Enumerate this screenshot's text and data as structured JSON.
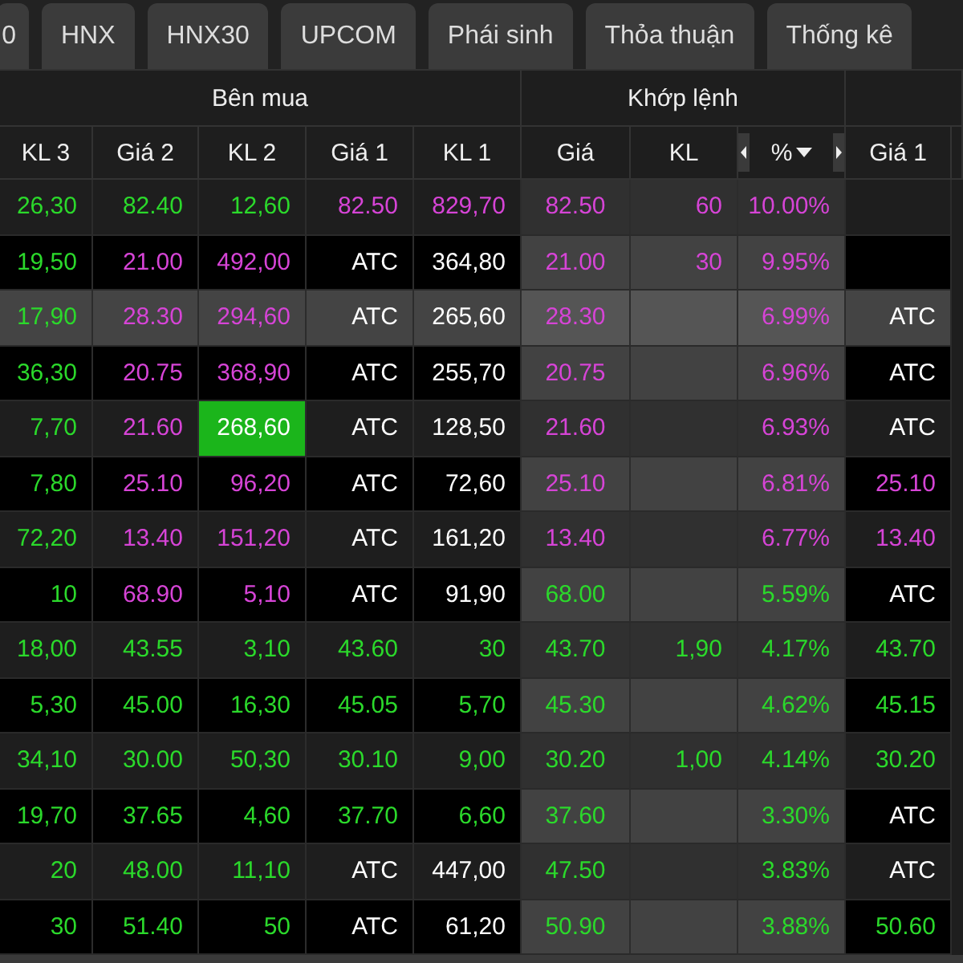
{
  "tabs": [
    {
      "label": "0",
      "selected": false
    },
    {
      "label": "HNX",
      "selected": false
    },
    {
      "label": "HNX30",
      "selected": false
    },
    {
      "label": "UPCOM",
      "selected": false
    },
    {
      "label": "Phái sinh",
      "selected": false
    },
    {
      "label": "Thỏa thuận",
      "selected": false
    },
    {
      "label": "Thống kê",
      "selected": false
    }
  ],
  "board": {
    "groups": [
      {
        "label": "Bên mua",
        "kind": "buy",
        "columns": [
          {
            "label": "KL 3",
            "kind": "plain"
          },
          {
            "label": "Giá 2",
            "kind": "plain"
          },
          {
            "label": "KL 2",
            "kind": "plain"
          },
          {
            "label": "Giá 1",
            "kind": "plain"
          },
          {
            "label": "KL 1",
            "kind": "plain"
          }
        ]
      },
      {
        "label": "Khớp lệnh",
        "kind": "match",
        "columns": [
          {
            "label": "Giá",
            "kind": "plain"
          },
          {
            "label": "KL",
            "kind": "plain"
          },
          {
            "label": "%",
            "kind": "sort"
          }
        ]
      },
      {
        "kind": "sell",
        "columns": [
          {
            "label": "Giá 1",
            "kind": "plain"
          }
        ]
      }
    ],
    "rows": [
      {
        "selected": false,
        "cells": [
          {
            "text": "26,30",
            "color": "#2bd92b",
            "highlighted": false
          },
          {
            "text": "82.40",
            "color": "#2bd92b",
            "highlighted": false
          },
          {
            "text": "12,60",
            "color": "#2bd92b",
            "highlighted": false
          },
          {
            "text": "82.50",
            "color": "#d644d6",
            "highlighted": false
          },
          {
            "text": "829,70",
            "color": "#d644d6",
            "highlighted": false
          },
          {
            "text": "82.50",
            "color": "#d644d6",
            "highlighted": false
          },
          {
            "text": "60",
            "color": "#d644d6",
            "highlighted": false
          },
          {
            "text": "10.00%",
            "color": "#d644d6",
            "highlighted": false
          },
          null
        ]
      },
      {
        "selected": false,
        "cells": [
          {
            "text": "19,50",
            "color": "#2bd92b",
            "highlighted": false
          },
          {
            "text": "21.00",
            "color": "#d644d6",
            "highlighted": false
          },
          {
            "text": "492,00",
            "color": "#d644d6",
            "highlighted": false
          },
          {
            "text": "ATC",
            "color": "#ffffff",
            "highlighted": false
          },
          {
            "text": "364,80",
            "color": "#ffffff",
            "highlighted": false
          },
          {
            "text": "21.00",
            "color": "#d644d6",
            "highlighted": false
          },
          {
            "text": "30",
            "color": "#d644d6",
            "highlighted": false
          },
          {
            "text": "9.95%",
            "color": "#d644d6",
            "highlighted": false
          },
          null
        ]
      },
      {
        "selected": true,
        "cells": [
          {
            "text": "17,90",
            "color": "#2bd92b",
            "highlighted": false
          },
          {
            "text": "28.30",
            "color": "#d644d6",
            "highlighted": false
          },
          {
            "text": "294,60",
            "color": "#d644d6",
            "highlighted": false
          },
          {
            "text": "ATC",
            "color": "#ffffff",
            "highlighted": false
          },
          {
            "text": "265,60",
            "color": "#ffffff",
            "highlighted": false
          },
          {
            "text": "28.30",
            "color": "#d644d6",
            "highlighted": false
          },
          null,
          {
            "text": "6.99%",
            "color": "#d644d6",
            "highlighted": false
          },
          {
            "text": "ATC",
            "color": "#ffffff",
            "highlighted": false
          }
        ]
      },
      {
        "selected": false,
        "cells": [
          {
            "text": "36,30",
            "color": "#2bd92b",
            "highlighted": false
          },
          {
            "text": "20.75",
            "color": "#d644d6",
            "highlighted": false
          },
          {
            "text": "368,90",
            "color": "#d644d6",
            "highlighted": false
          },
          {
            "text": "ATC",
            "color": "#ffffff",
            "highlighted": false
          },
          {
            "text": "255,70",
            "color": "#ffffff",
            "highlighted": false
          },
          {
            "text": "20.75",
            "color": "#d644d6",
            "highlighted": false
          },
          null,
          {
            "text": "6.96%",
            "color": "#d644d6",
            "highlighted": false
          },
          {
            "text": "ATC",
            "color": "#ffffff",
            "highlighted": false
          }
        ]
      },
      {
        "selected": false,
        "cells": [
          {
            "text": "7,70",
            "color": "#2bd92b",
            "highlighted": false
          },
          {
            "text": "21.60",
            "color": "#d644d6",
            "highlighted": false
          },
          {
            "text": "268,60",
            "color": "#ffffff",
            "highlighted": true
          },
          {
            "text": "ATC",
            "color": "#ffffff",
            "highlighted": false
          },
          {
            "text": "128,50",
            "color": "#ffffff",
            "highlighted": false
          },
          {
            "text": "21.60",
            "color": "#d644d6",
            "highlighted": false
          },
          null,
          {
            "text": "6.93%",
            "color": "#d644d6",
            "highlighted": false
          },
          {
            "text": "ATC",
            "color": "#ffffff",
            "highlighted": false
          }
        ]
      },
      {
        "selected": false,
        "cells": [
          {
            "text": "7,80",
            "color": "#2bd92b",
            "highlighted": false
          },
          {
            "text": "25.10",
            "color": "#d644d6",
            "highlighted": false
          },
          {
            "text": "96,20",
            "color": "#d644d6",
            "highlighted": false
          },
          {
            "text": "ATC",
            "color": "#ffffff",
            "highlighted": false
          },
          {
            "text": "72,60",
            "color": "#ffffff",
            "highlighted": false
          },
          {
            "text": "25.10",
            "color": "#d644d6",
            "highlighted": false
          },
          null,
          {
            "text": "6.81%",
            "color": "#d644d6",
            "highlighted": false
          },
          {
            "text": "25.10",
            "color": "#d644d6",
            "highlighted": false
          }
        ]
      },
      {
        "selected": false,
        "cells": [
          {
            "text": "72,20",
            "color": "#2bd92b",
            "highlighted": false
          },
          {
            "text": "13.40",
            "color": "#d644d6",
            "highlighted": false
          },
          {
            "text": "151,20",
            "color": "#d644d6",
            "highlighted": false
          },
          {
            "text": "ATC",
            "color": "#ffffff",
            "highlighted": false
          },
          {
            "text": "161,20",
            "color": "#ffffff",
            "highlighted": false
          },
          {
            "text": "13.40",
            "color": "#d644d6",
            "highlighted": false
          },
          null,
          {
            "text": "6.77%",
            "color": "#d644d6",
            "highlighted": false
          },
          {
            "text": "13.40",
            "color": "#d644d6",
            "highlighted": false
          }
        ]
      },
      {
        "selected": false,
        "cells": [
          {
            "text": "10",
            "color": "#2bd92b",
            "highlighted": false
          },
          {
            "text": "68.90",
            "color": "#d644d6",
            "highlighted": false
          },
          {
            "text": "5,10",
            "color": "#d644d6",
            "highlighted": false
          },
          {
            "text": "ATC",
            "color": "#ffffff",
            "highlighted": false
          },
          {
            "text": "91,90",
            "color": "#ffffff",
            "highlighted": false
          },
          {
            "text": "68.00",
            "color": "#2bd92b",
            "highlighted": false
          },
          null,
          {
            "text": "5.59%",
            "color": "#2bd92b",
            "highlighted": false
          },
          {
            "text": "ATC",
            "color": "#ffffff",
            "highlighted": false
          }
        ]
      },
      {
        "selected": false,
        "cells": [
          {
            "text": "18,00",
            "color": "#2bd92b",
            "highlighted": false
          },
          {
            "text": "43.55",
            "color": "#2bd92b",
            "highlighted": false
          },
          {
            "text": "3,10",
            "color": "#2bd92b",
            "highlighted": false
          },
          {
            "text": "43.60",
            "color": "#2bd92b",
            "highlighted": false
          },
          {
            "text": "30",
            "color": "#2bd92b",
            "highlighted": false
          },
          {
            "text": "43.70",
            "color": "#2bd92b",
            "highlighted": false
          },
          {
            "text": "1,90",
            "color": "#2bd92b",
            "highlighted": false
          },
          {
            "text": "4.17%",
            "color": "#2bd92b",
            "highlighted": false
          },
          {
            "text": "43.70",
            "color": "#2bd92b",
            "highlighted": false
          }
        ]
      },
      {
        "selected": false,
        "cells": [
          {
            "text": "5,30",
            "color": "#2bd92b",
            "highlighted": false
          },
          {
            "text": "45.00",
            "color": "#2bd92b",
            "highlighted": false
          },
          {
            "text": "16,30",
            "color": "#2bd92b",
            "highlighted": false
          },
          {
            "text": "45.05",
            "color": "#2bd92b",
            "highlighted": false
          },
          {
            "text": "5,70",
            "color": "#2bd92b",
            "highlighted": false
          },
          {
            "text": "45.30",
            "color": "#2bd92b",
            "highlighted": false
          },
          null,
          {
            "text": "4.62%",
            "color": "#2bd92b",
            "highlighted": false
          },
          {
            "text": "45.15",
            "color": "#2bd92b",
            "highlighted": false
          }
        ]
      },
      {
        "selected": false,
        "cells": [
          {
            "text": "34,10",
            "color": "#2bd92b",
            "highlighted": false
          },
          {
            "text": "30.00",
            "color": "#2bd92b",
            "highlighted": false
          },
          {
            "text": "50,30",
            "color": "#2bd92b",
            "highlighted": false
          },
          {
            "text": "30.10",
            "color": "#2bd92b",
            "highlighted": false
          },
          {
            "text": "9,00",
            "color": "#2bd92b",
            "highlighted": false
          },
          {
            "text": "30.20",
            "color": "#2bd92b",
            "highlighted": false
          },
          {
            "text": "1,00",
            "color": "#2bd92b",
            "highlighted": false
          },
          {
            "text": "4.14%",
            "color": "#2bd92b",
            "highlighted": false
          },
          {
            "text": "30.20",
            "color": "#2bd92b",
            "highlighted": false
          }
        ]
      },
      {
        "selected": false,
        "cells": [
          {
            "text": "19,70",
            "color": "#2bd92b",
            "highlighted": false
          },
          {
            "text": "37.65",
            "color": "#2bd92b",
            "highlighted": false
          },
          {
            "text": "4,60",
            "color": "#2bd92b",
            "highlighted": false
          },
          {
            "text": "37.70",
            "color": "#2bd92b",
            "highlighted": false
          },
          {
            "text": "6,60",
            "color": "#2bd92b",
            "highlighted": false
          },
          {
            "text": "37.60",
            "color": "#2bd92b",
            "highlighted": false
          },
          null,
          {
            "text": "3.30%",
            "color": "#2bd92b",
            "highlighted": false
          },
          {
            "text": "ATC",
            "color": "#ffffff",
            "highlighted": false
          }
        ]
      },
      {
        "selected": false,
        "cells": [
          {
            "text": "20",
            "color": "#2bd92b",
            "highlighted": false
          },
          {
            "text": "48.00",
            "color": "#2bd92b",
            "highlighted": false
          },
          {
            "text": "11,10",
            "color": "#2bd92b",
            "highlighted": false
          },
          {
            "text": "ATC",
            "color": "#ffffff",
            "highlighted": false
          },
          {
            "text": "447,00",
            "color": "#ffffff",
            "highlighted": false
          },
          {
            "text": "47.50",
            "color": "#2bd92b",
            "highlighted": false
          },
          null,
          {
            "text": "3.83%",
            "color": "#2bd92b",
            "highlighted": false
          },
          {
            "text": "ATC",
            "color": "#ffffff",
            "highlighted": false
          }
        ]
      },
      {
        "selected": false,
        "cells": [
          {
            "text": "30",
            "color": "#2bd92b",
            "highlighted": false
          },
          {
            "text": "51.40",
            "color": "#2bd92b",
            "highlighted": false
          },
          {
            "text": "50",
            "color": "#2bd92b",
            "highlighted": false
          },
          {
            "text": "ATC",
            "color": "#ffffff",
            "highlighted": false
          },
          {
            "text": "61,20",
            "color": "#ffffff",
            "highlighted": false
          },
          {
            "text": "50.90",
            "color": "#2bd92b",
            "highlighted": false
          },
          null,
          {
            "text": "3.88%",
            "color": "#2bd92b",
            "highlighted": false
          },
          {
            "text": "50.60",
            "color": "#2bd92b",
            "highlighted": false
          }
        ]
      }
    ]
  }
}
